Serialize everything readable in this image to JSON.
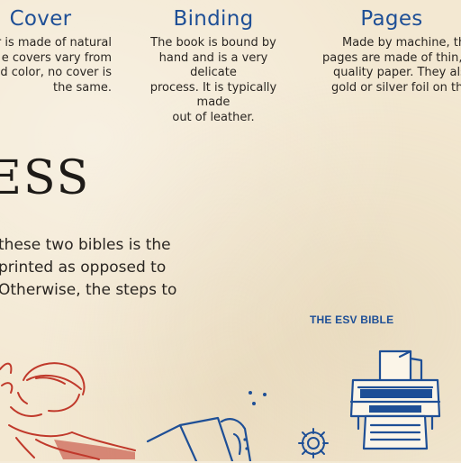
{
  "columns": [
    {
      "title": "Cover",
      "lines": [
        "r is made of natural",
        "e covers vary from",
        "d color, no cover is",
        "the same."
      ]
    },
    {
      "title": "Binding",
      "lines": [
        "The book is bound by",
        "hand and is a very delicate",
        "process. It is typically made",
        "out of leather."
      ]
    },
    {
      "title": "Pages",
      "lines": [
        "Made by machine, th",
        "pages are made of thin,",
        "quality paper. They also",
        "gold or silver foil on th"
      ]
    }
  ],
  "section_heading": "ESS",
  "body_lines": [
    "these two bibles is the",
    "printed as opposed to",
    "Otherwise, the steps to"
  ],
  "esv_label": "THE ESV BIBLE",
  "colors": {
    "accent_blue": "#1e4f96",
    "illustration_red": "#c0392b",
    "background": "#f3e8d2"
  },
  "illustrations": [
    "press-worker-illustration",
    "printer-icon",
    "gear-icon",
    "book-pages-illustration"
  ]
}
